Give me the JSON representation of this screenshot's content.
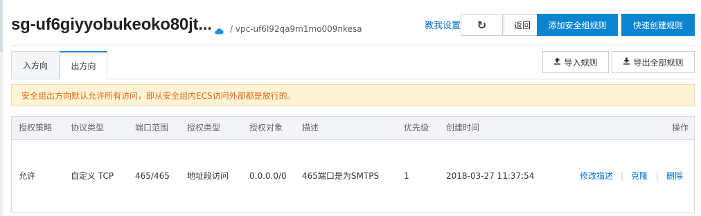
{
  "header": {
    "title": "sg-uf6giyyobukeoko80jt...",
    "vpc": "/ vpc-uf6l92qa9m1mo009nkesa",
    "help_link": "教我设置",
    "refresh_icon": "↻",
    "back_label": "返回",
    "add_rule_label": "添加安全组规则",
    "quick_create_label": "快速创建规则"
  },
  "tabs": {
    "items": [
      {
        "label": "入方向",
        "active": false
      },
      {
        "label": "出方向",
        "active": true
      }
    ],
    "import_label": "导入规则",
    "export_label": "导出全部规则"
  },
  "notice": {
    "text": "安全组出方向默认允许所有访问，即从安全组内ECS访问外部都是放行的。",
    "color": "#e26a10"
  },
  "table": {
    "headers": [
      "授权策略",
      "协议类型",
      "端口范围",
      "授权类型",
      "授权对象",
      "描述",
      "优先级",
      "创建时间",
      "操作"
    ],
    "rows": [
      {
        "policy": "允许",
        "protocol": "自定义 TCP",
        "port_range": "465/465",
        "auth_type": "地址段访问",
        "auth_object": "0.0.0.0/0",
        "description": "465端口是为SMTPS",
        "priority": "1",
        "created": "2018-03-27 11:37:54",
        "actions": {
          "edit": "修改描述",
          "clone": "克隆",
          "delete": "删除",
          "separator": "|"
        }
      }
    ]
  },
  "colors": {
    "accent": "#0a85d2",
    "link": "#0070cc",
    "notice_bg": "#fff3d6"
  }
}
